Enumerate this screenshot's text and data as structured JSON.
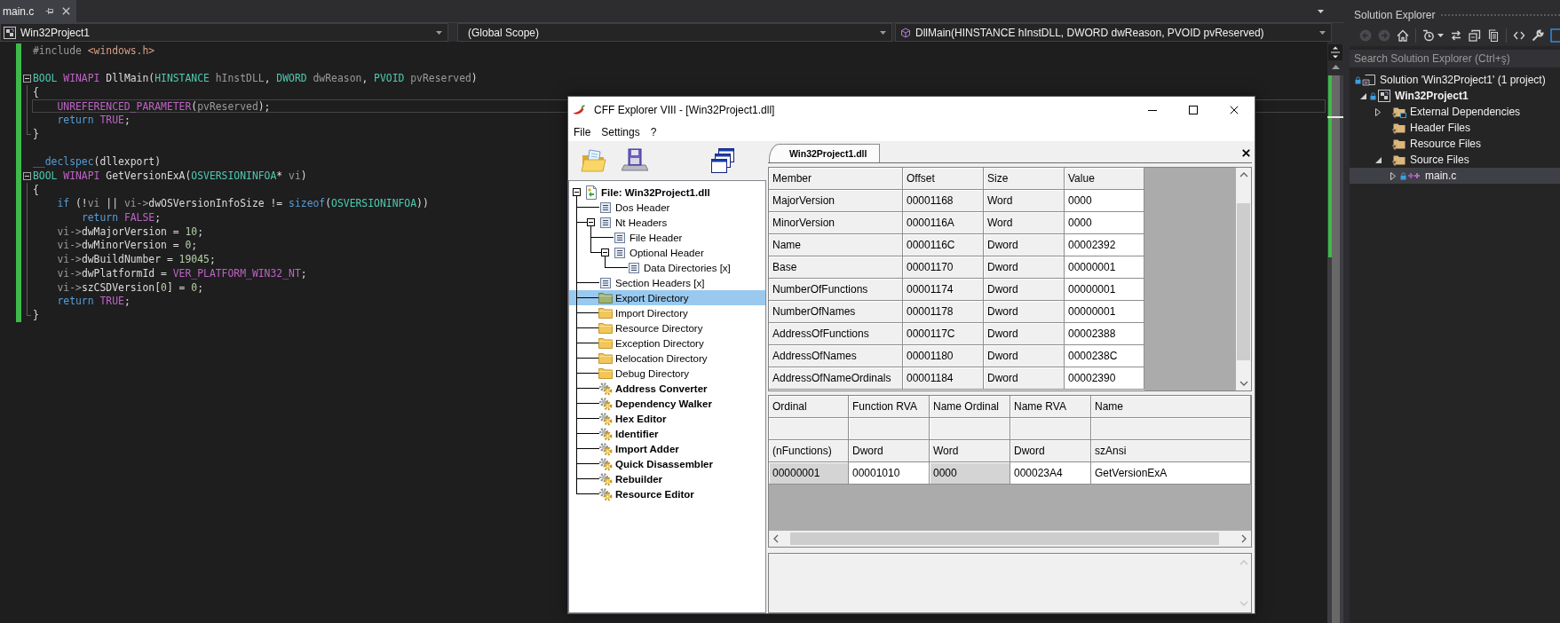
{
  "editor": {
    "tabs": [
      {
        "label": "main.c",
        "selected": true
      }
    ],
    "nav_bar": {
      "project": "Win32Project1",
      "scope": "(Global Scope)",
      "member": "DllMain(HINSTANCE hInstDLL, DWORD dwReason, PVOID pvReserved)"
    },
    "code": {
      "lines": [
        {
          "kind": "line",
          "tokens": [
            {
              "text": "#include ",
              "kind": "preproc"
            },
            {
              "text": "<windows.h>",
              "kind": "string"
            }
          ],
          "changed": true,
          "current": false
        },
        {
          "kind": "line",
          "changed": true,
          "current": false
        },
        {
          "kind": "opener",
          "expanded": true,
          "tokens": [
            {
              "text": "BOOL ",
              "kind": "type"
            },
            {
              "text": "WINAPI ",
              "kind": "macro"
            },
            {
              "text": "DllMain",
              "kind": "func"
            },
            {
              "text": "(",
              "kind": "plain"
            },
            {
              "text": "HINSTANCE ",
              "kind": "type"
            },
            {
              "text": "hInstDLL",
              "kind": "param"
            },
            {
              "text": ", ",
              "kind": "plain"
            },
            {
              "text": "DWORD ",
              "kind": "type"
            },
            {
              "text": "dwReason",
              "kind": "param"
            },
            {
              "text": ", ",
              "kind": "plain"
            },
            {
              "text": "PVOID ",
              "kind": "type"
            },
            {
              "text": "pvReserved",
              "kind": "param"
            },
            {
              "text": ")",
              "kind": "plain"
            }
          ],
          "changed": true,
          "current": false
        },
        {
          "kind": "line",
          "tokens": [
            {
              "text": "{",
              "kind": "plain"
            }
          ],
          "changed": true,
          "current": false
        },
        {
          "kind": "line",
          "tokens": [
            {
              "text": "    UNREFERENCED_PARAMETER",
              "kind": "macro"
            },
            {
              "text": "(",
              "kind": "plain"
            },
            {
              "text": "pvReserved",
              "kind": "param"
            },
            {
              "text": ");",
              "kind": "plain"
            }
          ],
          "changed": true,
          "current": true
        },
        {
          "kind": "line",
          "tokens": [
            {
              "text": "    return ",
              "kind": "keyword"
            },
            {
              "text": "TRUE",
              "kind": "macro"
            },
            {
              "text": ";",
              "kind": "plain"
            }
          ],
          "changed": true,
          "current": false
        },
        {
          "kind": "closer",
          "tokens": [
            {
              "text": "}",
              "kind": "plain"
            }
          ],
          "changed": true,
          "current": false
        },
        {
          "kind": "line",
          "changed": true,
          "current": false
        },
        {
          "kind": "line",
          "tokens": [
            {
              "text": "__declspec",
              "kind": "keyword"
            },
            {
              "text": "(dllexport)",
              "kind": "plain"
            }
          ],
          "changed": true,
          "current": false
        },
        {
          "kind": "opener",
          "expanded": true,
          "tokens": [
            {
              "text": "BOOL ",
              "kind": "type"
            },
            {
              "text": "WINAPI ",
              "kind": "macro"
            },
            {
              "text": "GetVersionExA",
              "kind": "func"
            },
            {
              "text": "(",
              "kind": "plain"
            },
            {
              "text": "OSVERSIONINFOA",
              "kind": "type"
            },
            {
              "text": "* ",
              "kind": "plain"
            },
            {
              "text": "vi",
              "kind": "param"
            },
            {
              "text": ")",
              "kind": "plain"
            }
          ],
          "changed": true,
          "current": false
        },
        {
          "kind": "line",
          "tokens": [
            {
              "text": "{",
              "kind": "plain"
            }
          ],
          "changed": true,
          "current": false
        },
        {
          "kind": "line",
          "tokens": [
            {
              "text": "    if ",
              "kind": "keyword"
            },
            {
              "text": "(!",
              "kind": "plain"
            },
            {
              "text": "vi",
              "kind": "param"
            },
            {
              "text": " || ",
              "kind": "plain"
            },
            {
              "text": "vi->",
              "kind": "param"
            },
            {
              "text": "dwOSVersionInfoSize != ",
              "kind": "plain"
            },
            {
              "text": "sizeof",
              "kind": "keyword"
            },
            {
              "text": "(",
              "kind": "plain"
            },
            {
              "text": "OSVERSIONINFOA",
              "kind": "type"
            },
            {
              "text": "))",
              "kind": "plain"
            }
          ],
          "changed": true,
          "current": false
        },
        {
          "kind": "line",
          "tokens": [
            {
              "text": "        return ",
              "kind": "keyword"
            },
            {
              "text": "FALSE",
              "kind": "macro"
            },
            {
              "text": ";",
              "kind": "plain"
            }
          ],
          "changed": true,
          "current": false
        },
        {
          "kind": "line",
          "tokens": [
            {
              "text": "    vi->",
              "kind": "param"
            },
            {
              "text": "dwMajorVersion = ",
              "kind": "plain"
            },
            {
              "text": "10",
              "kind": "number"
            },
            {
              "text": ";",
              "kind": "plain"
            }
          ],
          "changed": true,
          "current": false
        },
        {
          "kind": "line",
          "tokens": [
            {
              "text": "    vi->",
              "kind": "param"
            },
            {
              "text": "dwMinorVersion = ",
              "kind": "plain"
            },
            {
              "text": "0",
              "kind": "number"
            },
            {
              "text": ";",
              "kind": "plain"
            }
          ],
          "changed": true,
          "current": false
        },
        {
          "kind": "line",
          "tokens": [
            {
              "text": "    vi->",
              "kind": "param"
            },
            {
              "text": "dwBuildNumber = ",
              "kind": "plain"
            },
            {
              "text": "19045",
              "kind": "number"
            },
            {
              "text": ";",
              "kind": "plain"
            }
          ],
          "changed": true,
          "current": false
        },
        {
          "kind": "line",
          "tokens": [
            {
              "text": "    vi->",
              "kind": "param"
            },
            {
              "text": "dwPlatformId = ",
              "kind": "plain"
            },
            {
              "text": "VER_PLATFORM_WIN32_NT",
              "kind": "macro"
            },
            {
              "text": ";",
              "kind": "plain"
            }
          ],
          "changed": true,
          "current": false
        },
        {
          "kind": "line",
          "tokens": [
            {
              "text": "    vi->",
              "kind": "param"
            },
            {
              "text": "szCSDVersion[",
              "kind": "plain"
            },
            {
              "text": "0",
              "kind": "number"
            },
            {
              "text": "] = ",
              "kind": "plain"
            },
            {
              "text": "0",
              "kind": "number"
            },
            {
              "text": ";",
              "kind": "plain"
            }
          ],
          "changed": true,
          "current": false
        },
        {
          "kind": "line",
          "tokens": [
            {
              "text": "    return ",
              "kind": "keyword"
            },
            {
              "text": "TRUE",
              "kind": "macro"
            },
            {
              "text": ";",
              "kind": "plain"
            }
          ],
          "changed": true,
          "current": false
        },
        {
          "kind": "closer",
          "tokens": [
            {
              "text": "}",
              "kind": "plain"
            }
          ],
          "changed": true,
          "current": false
        }
      ]
    }
  },
  "cff_window": {
    "title": "CFF Explorer VIII - [Win32Project1.dll]",
    "menu": [
      "File",
      "Settings",
      "?"
    ],
    "tree": [
      {
        "label": "File: Win32Project1.dll",
        "kind": "file",
        "selected": false,
        "expanded": true,
        "children": [
          {
            "label": "Dos Header",
            "kind": "header",
            "selected": false
          },
          {
            "label": "Nt Headers",
            "kind": "header",
            "selected": false,
            "expanded": true,
            "children": [
              {
                "label": "File Header",
                "kind": "header",
                "selected": false
              },
              {
                "label": "Optional Header",
                "kind": "header",
                "selected": false,
                "expanded": true,
                "children": [
                  {
                    "label": "Data Directories [x]",
                    "kind": "header",
                    "selected": false
                  }
                ]
              }
            ]
          },
          {
            "label": "Section Headers [x]",
            "kind": "header",
            "selected": false
          },
          {
            "label": "Export Directory",
            "kind": "directory",
            "selected": true
          },
          {
            "label": "Import Directory",
            "kind": "directory",
            "selected": false
          },
          {
            "label": "Resource Directory",
            "kind": "directory",
            "selected": false
          },
          {
            "label": "Exception Directory",
            "kind": "directory",
            "selected": false
          },
          {
            "label": "Relocation Directory",
            "kind": "directory",
            "selected": false
          },
          {
            "label": "Debug Directory",
            "kind": "directory",
            "selected": false
          },
          {
            "label": "Address Converter",
            "kind": "tool",
            "selected": false
          },
          {
            "label": "Dependency Walker",
            "kind": "tool",
            "selected": false
          },
          {
            "label": "Hex Editor",
            "kind": "tool",
            "selected": false
          },
          {
            "label": "Identifier",
            "kind": "tool",
            "selected": false
          },
          {
            "label": "Import Adder",
            "kind": "tool",
            "selected": false
          },
          {
            "label": "Quick Disassembler",
            "kind": "tool",
            "selected": false
          },
          {
            "label": "Rebuilder",
            "kind": "tool",
            "selected": false
          },
          {
            "label": "Resource Editor",
            "kind": "tool",
            "selected": false
          }
        ]
      }
    ],
    "tabs": [
      {
        "label": "Win32Project1.dll",
        "selected": true
      }
    ],
    "members_table": {
      "columns": [
        {
          "label": "Member",
          "shaded": true
        },
        {
          "label": "Offset",
          "shaded": true
        },
        {
          "label": "Size",
          "shaded": true
        },
        {
          "label": "Value",
          "shaded": false
        }
      ],
      "rows": [
        [
          "MajorVersion",
          "00001168",
          "Word",
          "0000"
        ],
        [
          "MinorVersion",
          "0000116A",
          "Word",
          "0000"
        ],
        [
          "Name",
          "0000116C",
          "Dword",
          "00002392"
        ],
        [
          "Base",
          "00001170",
          "Dword",
          "00000001"
        ],
        [
          "NumberOfFunctions",
          "00001174",
          "Dword",
          "00000001"
        ],
        [
          "NumberOfNames",
          "00001178",
          "Dword",
          "00000001"
        ],
        [
          "AddressOfFunctions",
          "0000117C",
          "Dword",
          "00002388"
        ],
        [
          "AddressOfNames",
          "00001180",
          "Dword",
          "0000238C"
        ],
        [
          "AddressOfNameOrdinals",
          "00001184",
          "Dword",
          "00002390"
        ]
      ]
    },
    "exports_table": {
      "columns": [
        {
          "label": "Ordinal",
          "type": "(nFunctions)",
          "shaded": true
        },
        {
          "label": "Function RVA",
          "type": "Dword",
          "shaded": false
        },
        {
          "label": "Name Ordinal",
          "type": "Word",
          "shaded": true
        },
        {
          "label": "Name RVA",
          "type": "Dword",
          "shaded": false
        },
        {
          "label": "Name",
          "type": "szAnsi",
          "shaded": false
        }
      ],
      "rows": [
        [
          "00000001",
          "00001010",
          "0000",
          "000023A4",
          "GetVersionExA"
        ]
      ]
    }
  },
  "solution_explorer": {
    "title": "Solution Explorer",
    "search": {
      "placeholder": "Search Solution Explorer (Ctrl+ş)"
    },
    "tree": [
      {
        "label": "Solution 'Win32Project1' (1 project)",
        "kind": "solution",
        "locked": true,
        "selected": false,
        "children": [
          {
            "label": "Win32Project1",
            "kind": "project",
            "locked": true,
            "expanded": true,
            "selected": false,
            "children": [
              {
                "label": "External Dependencies",
                "kind": "dependencies",
                "locked": false,
                "expanded": false,
                "selected": false
              },
              {
                "label": "Header Files",
                "kind": "filter",
                "locked": false,
                "selected": false
              },
              {
                "label": "Resource Files",
                "kind": "filter",
                "locked": false,
                "selected": false
              },
              {
                "label": "Source Files",
                "kind": "filter",
                "locked": false,
                "expanded": true,
                "selected": false,
                "children": [
                  {
                    "label": "main.c",
                    "kind": "cfile",
                    "locked": true,
                    "expanded": false,
                    "selected": true
                  }
                ]
              }
            ]
          }
        ]
      }
    ]
  }
}
